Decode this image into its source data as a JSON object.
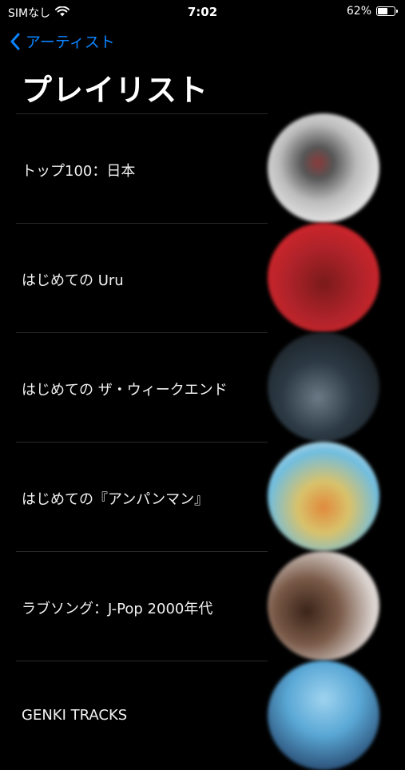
{
  "status_bar": {
    "carrier": "SIMなし",
    "time": "7:02",
    "battery_text": "62%",
    "battery_level": 0.62
  },
  "nav": {
    "back_label": "アーティスト"
  },
  "page": {
    "title": "プレイリスト"
  },
  "playlists": [
    {
      "title": "トップ100：日本"
    },
    {
      "title": "はじめての Uru"
    },
    {
      "title": "はじめての ザ・ウィークエンド"
    },
    {
      "title": "はじめての『アンパンマン』"
    },
    {
      "title": "ラブソング：J-Pop 2000年代"
    },
    {
      "title": "GENKI TRACKS"
    }
  ],
  "colors": {
    "background": "#000000",
    "accent": "#0a84ff",
    "text": "#ffffff"
  }
}
